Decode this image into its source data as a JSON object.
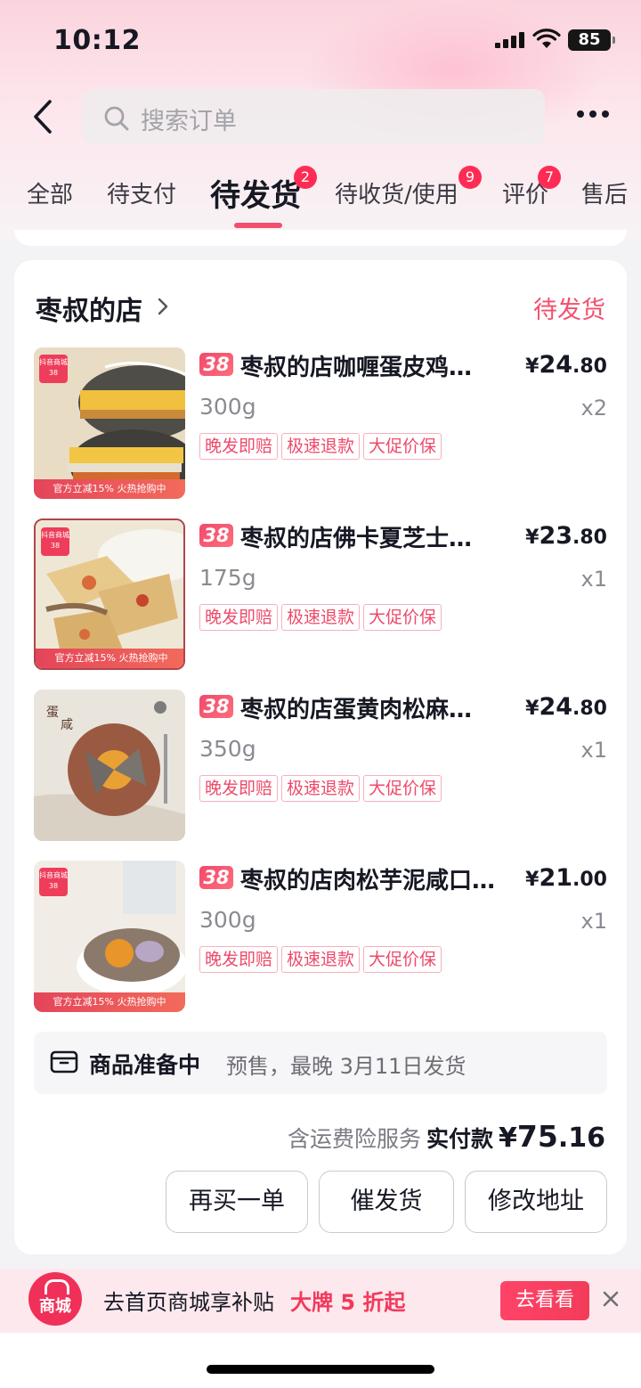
{
  "status_bar": {
    "time": "10:12",
    "battery": "85"
  },
  "nav": {
    "search_placeholder": "搜索订单"
  },
  "tabs": [
    {
      "label": "全部"
    },
    {
      "label": "待支付"
    },
    {
      "label": "待发货",
      "badge": "2",
      "active": true
    },
    {
      "label": "待收货/使用",
      "badge": "9"
    },
    {
      "label": "评价",
      "badge": "7"
    },
    {
      "label": "售后"
    }
  ],
  "order": {
    "shop_name": "枣叔的店",
    "status": "待发货",
    "items": [
      {
        "title": "枣叔的店咖喱蛋皮鸡…",
        "price_symbol": "¥",
        "price_int": "24",
        "price_dec": ".80",
        "spec": "300g",
        "qty": "x2",
        "thumb_banner": "官方立减15%  火热抢购中"
      },
      {
        "title": "枣叔的店佛卡夏芝士…",
        "price_symbol": "¥",
        "price_int": "23",
        "price_dec": ".80",
        "spec": "175g",
        "qty": "x1",
        "thumb_banner": "官方立减15%  火热抢购中"
      },
      {
        "title": "枣叔的店蛋黄肉松麻…",
        "price_symbol": "¥",
        "price_int": "24",
        "price_dec": ".80",
        "spec": "350g",
        "qty": "x1"
      },
      {
        "title": "枣叔的店肉松芋泥咸口…",
        "price_symbol": "¥",
        "price_int": "21",
        "price_dec": ".00",
        "spec": "300g",
        "qty": "x1",
        "thumb_banner": "官方立减15%  火热抢购中"
      }
    ],
    "promo_badge": "38",
    "tags": [
      "晚发即赔",
      "极速退款",
      "大促价保"
    ],
    "prep_title": "商品准备中",
    "prep_note": "预售，最晚 3月11日发货",
    "service_note": "含运费险服务",
    "paid_label": "实付款",
    "paid_symbol": "¥",
    "paid_int": "75",
    "paid_dec": ".16",
    "buttons": {
      "rebuy": "再买一单",
      "urge": "催发货",
      "edit_address": "修改地址"
    }
  },
  "banner": {
    "logo_text": "商城",
    "text": "去首页商城享补贴",
    "highlight": "大牌 5 折起",
    "button": "去看看"
  },
  "colors": {
    "accent": "#f2506e",
    "badge": "#fe2c55"
  }
}
